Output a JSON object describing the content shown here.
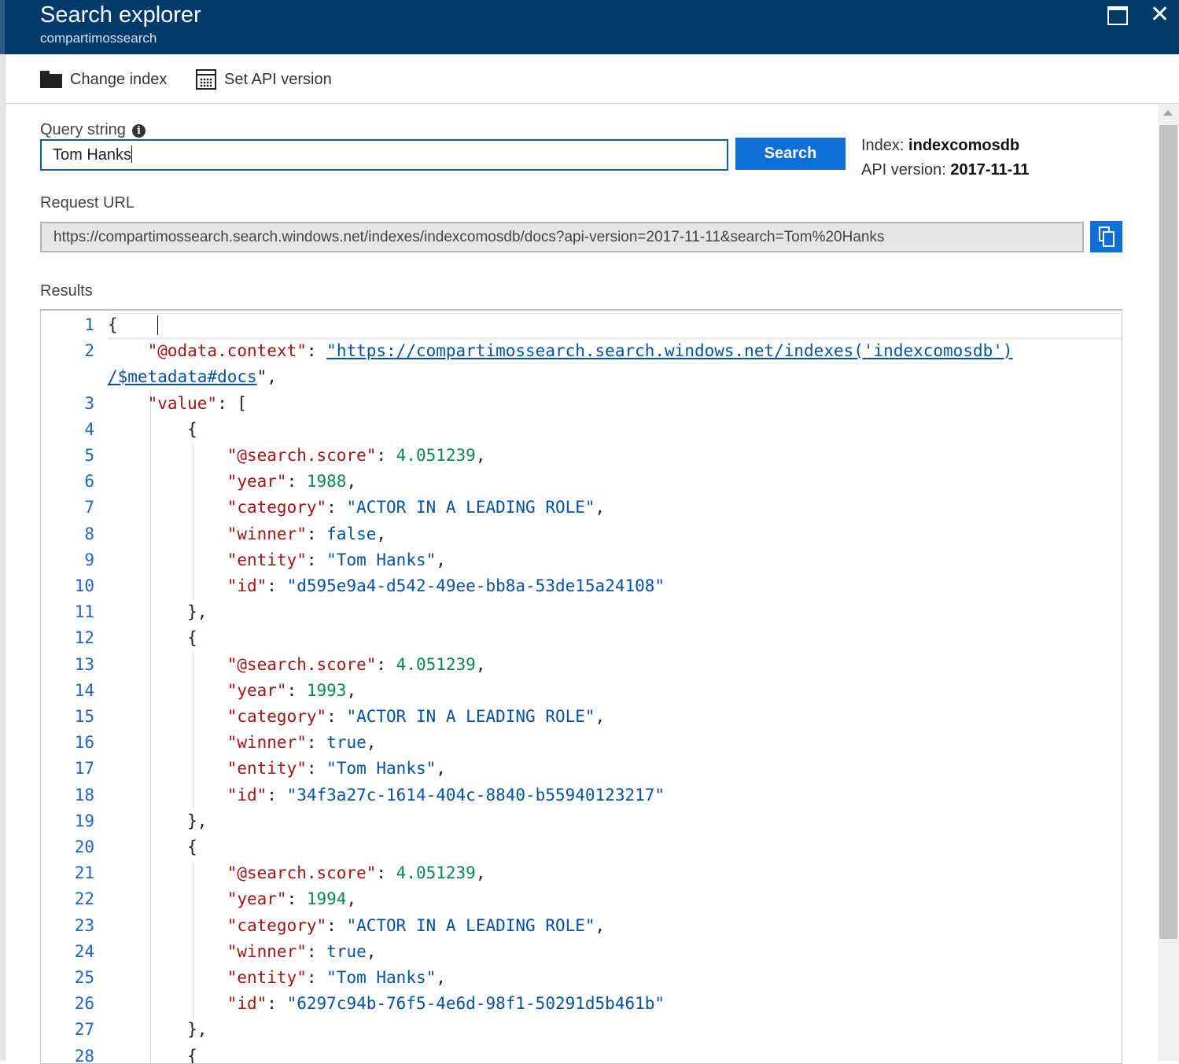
{
  "window": {
    "title": "Search explorer",
    "subtitle": "compartimossearch",
    "maximize_label": "",
    "close_label": "✕"
  },
  "toolbar": {
    "change_index": "Change index",
    "set_api_version": "Set API version"
  },
  "query": {
    "label": "Query string",
    "info_glyph": "i",
    "value": "Tom Hanks",
    "search_button": "Search"
  },
  "index_info": {
    "index_label": "Index: ",
    "index_value": "indexcomosdb",
    "api_label": "API version: ",
    "api_value": "2017-11-11"
  },
  "request": {
    "label": "Request URL",
    "url": "https://compartimossearch.search.windows.net/indexes/indexcomosdb/docs?api-version=2017-11-11&search=Tom%20Hanks"
  },
  "results": {
    "label": "Results",
    "odata_key": "\"@odata.context\"",
    "odata_url_part1": "\"https://compartimossearch.search.windows.net/indexes('indexcomosdb')",
    "odata_url_part2": "/$metadata#docs",
    "value_key": "\"value\"",
    "documents": [
      {
        "score": "4.051239",
        "year": "1988",
        "category": "\"ACTOR IN A LEADING ROLE\"",
        "winner": "false",
        "entity": "\"Tom Hanks\"",
        "id": "\"d595e9a4-d542-49ee-bb8a-53de15a24108\""
      },
      {
        "score": "4.051239",
        "year": "1993",
        "category": "\"ACTOR IN A LEADING ROLE\"",
        "winner": "true",
        "entity": "\"Tom Hanks\"",
        "id": "\"34f3a27c-1614-404c-8840-b55940123217\""
      },
      {
        "score": "4.051239",
        "year": "1994",
        "category": "\"ACTOR IN A LEADING ROLE\"",
        "winner": "true",
        "entity": "\"Tom Hanks\"",
        "id": "\"6297c94b-76f5-4e6d-98f1-50291d5b461b\""
      }
    ],
    "keys": {
      "score": "\"@search.score\"",
      "year": "\"year\"",
      "category": "\"category\"",
      "winner": "\"winner\"",
      "entity": "\"entity\"",
      "id": "\"id\""
    },
    "line_numbers": [
      "1",
      "2",
      "3",
      "4",
      "5",
      "6",
      "7",
      "8",
      "9",
      "10",
      "11",
      "12",
      "13",
      "14",
      "15",
      "16",
      "17",
      "18",
      "19",
      "20",
      "21",
      "22",
      "23",
      "24",
      "25",
      "26",
      "27",
      "28"
    ]
  },
  "colors": {
    "header_bg": "#003a6c",
    "accent": "#0f6fd8",
    "json_key": "#a31515",
    "json_string": "#0451a5",
    "json_number": "#098658"
  }
}
